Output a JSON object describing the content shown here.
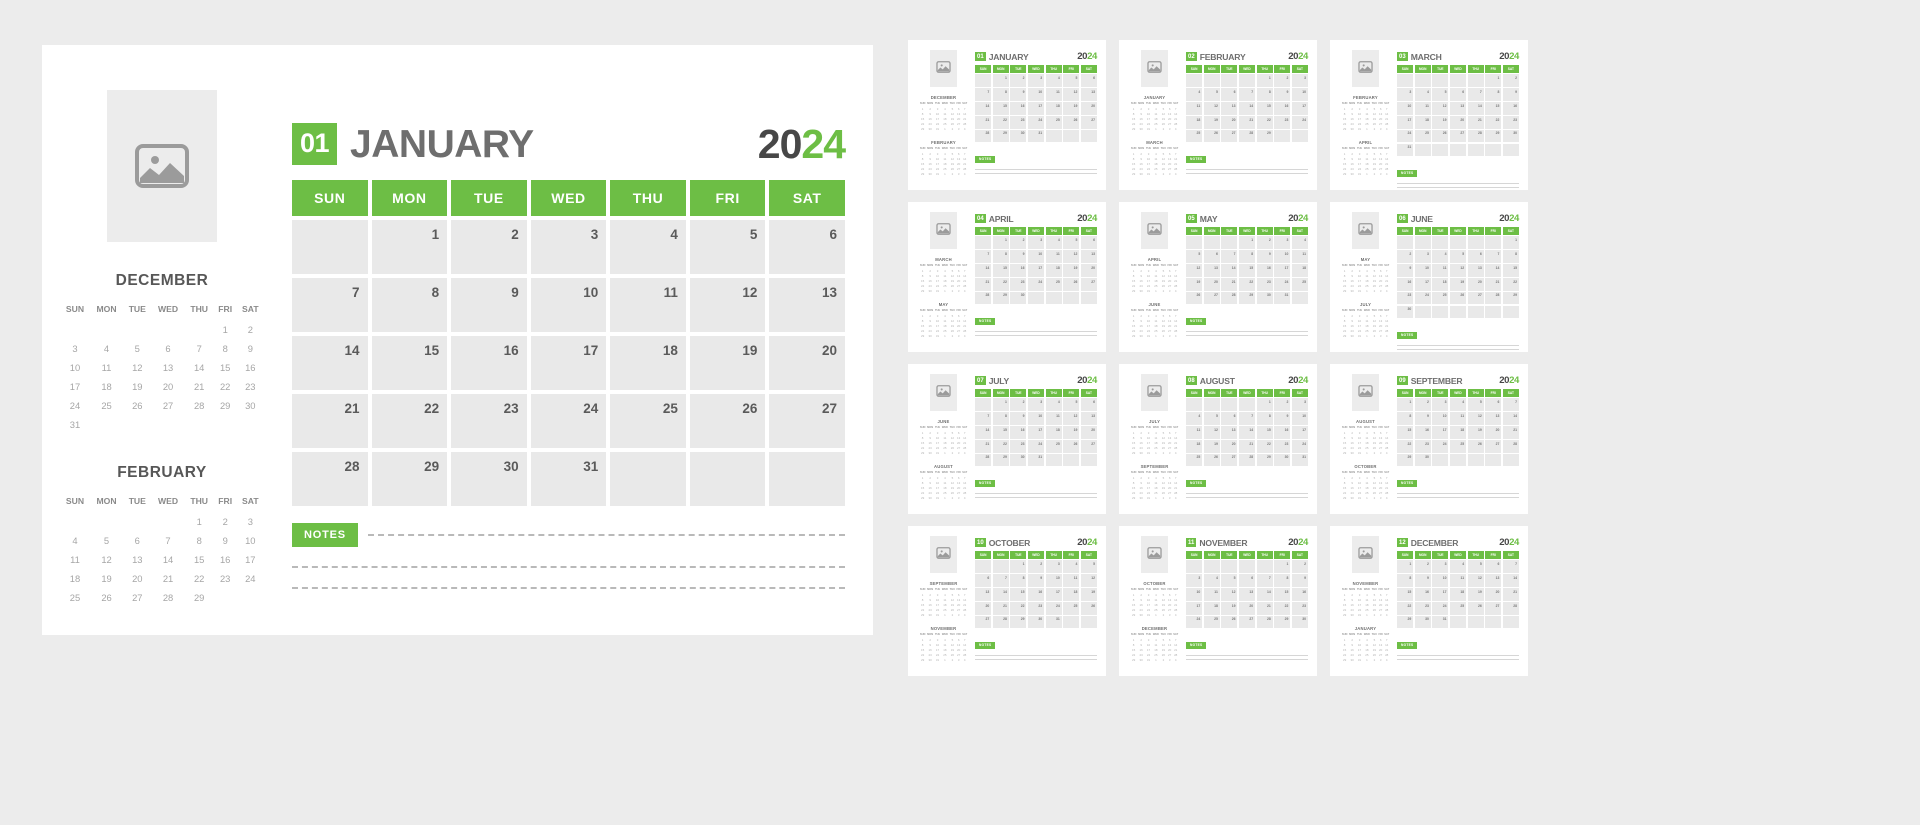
{
  "brand": {
    "green": "#6DBE45",
    "dark": "#474747",
    "gray_text": "#6e6e6e"
  },
  "year": {
    "part1": "20",
    "part2": "24",
    "full": "2024"
  },
  "weekday_headers": [
    "SUN",
    "MON",
    "TUE",
    "WED",
    "THU",
    "FRI",
    "SAT"
  ],
  "mini_weekday_headers": [
    "SUN",
    "MON",
    "TUE",
    "WED",
    "THU",
    "FRI",
    "SAT"
  ],
  "notes": {
    "label": "NOTES"
  },
  "photo_placeholder": {
    "icon": "image-placeholder-icon"
  },
  "main": {
    "month_number": "01",
    "month_name": "JANUARY",
    "weeks": [
      [
        "",
        "1",
        "2",
        "3",
        "4",
        "5",
        "6"
      ],
      [
        "7",
        "8",
        "9",
        "10",
        "11",
        "12",
        "13"
      ],
      [
        "14",
        "15",
        "16",
        "17",
        "18",
        "19",
        "20"
      ],
      [
        "21",
        "22",
        "23",
        "24",
        "25",
        "26",
        "27"
      ],
      [
        "28",
        "29",
        "30",
        "31",
        "",
        "",
        ""
      ]
    ],
    "prev_mini": {
      "title": "DECEMBER",
      "weeks": [
        [
          "",
          "",
          "",
          "",
          "",
          "1",
          "2"
        ],
        [
          "3",
          "4",
          "5",
          "6",
          "7",
          "8",
          "9"
        ],
        [
          "10",
          "11",
          "12",
          "13",
          "14",
          "15",
          "16"
        ],
        [
          "17",
          "18",
          "19",
          "20",
          "21",
          "22",
          "23"
        ],
        [
          "24",
          "25",
          "26",
          "27",
          "28",
          "29",
          "30"
        ],
        [
          "31",
          "",
          "",
          "",
          "",
          "",
          ""
        ]
      ]
    },
    "next_mini": {
      "title": "FEBRUARY",
      "weeks": [
        [
          "",
          "",
          "",
          "",
          "1",
          "2",
          "3"
        ],
        [
          "4",
          "5",
          "6",
          "7",
          "8",
          "9",
          "10"
        ],
        [
          "11",
          "12",
          "13",
          "14",
          "15",
          "16",
          "17"
        ],
        [
          "18",
          "19",
          "20",
          "21",
          "22",
          "23",
          "24"
        ],
        [
          "25",
          "26",
          "27",
          "28",
          "29",
          "",
          ""
        ]
      ]
    }
  },
  "thumbnails": [
    {
      "month_number": "01",
      "month_name": "JANUARY",
      "prev_mini": {
        "title": "DECEMBER"
      },
      "next_mini": {
        "title": "FEBRUARY"
      },
      "weeks": [
        [
          "",
          "1",
          "2",
          "3",
          "4",
          "5",
          "6"
        ],
        [
          "7",
          "8",
          "9",
          "10",
          "11",
          "12",
          "13"
        ],
        [
          "14",
          "15",
          "16",
          "17",
          "18",
          "19",
          "20"
        ],
        [
          "21",
          "22",
          "23",
          "24",
          "25",
          "26",
          "27"
        ],
        [
          "28",
          "29",
          "30",
          "31",
          "",
          "",
          ""
        ]
      ]
    },
    {
      "month_number": "02",
      "month_name": "FEBRUARY",
      "prev_mini": {
        "title": "JANUARY"
      },
      "next_mini": {
        "title": "MARCH"
      },
      "weeks": [
        [
          "",
          "",
          "",
          "",
          "1",
          "2",
          "3"
        ],
        [
          "4",
          "5",
          "6",
          "7",
          "8",
          "9",
          "10"
        ],
        [
          "11",
          "12",
          "13",
          "14",
          "15",
          "16",
          "17"
        ],
        [
          "18",
          "19",
          "20",
          "21",
          "22",
          "23",
          "24"
        ],
        [
          "25",
          "26",
          "27",
          "28",
          "29",
          "",
          ""
        ]
      ]
    },
    {
      "month_number": "03",
      "month_name": "MARCH",
      "prev_mini": {
        "title": "FEBRUARY"
      },
      "next_mini": {
        "title": "APRIL"
      },
      "weeks": [
        [
          "",
          "",
          "",
          "",
          "",
          "1",
          "2"
        ],
        [
          "3",
          "4",
          "5",
          "6",
          "7",
          "8",
          "9"
        ],
        [
          "10",
          "11",
          "12",
          "13",
          "14",
          "15",
          "16"
        ],
        [
          "17",
          "18",
          "19",
          "20",
          "21",
          "22",
          "23"
        ],
        [
          "24",
          "25",
          "26",
          "27",
          "28",
          "29",
          "30"
        ],
        [
          "31",
          "",
          "",
          "",
          "",
          "",
          ""
        ]
      ]
    },
    {
      "month_number": "04",
      "month_name": "APRIL",
      "prev_mini": {
        "title": "MARCH"
      },
      "next_mini": {
        "title": "MAY"
      },
      "weeks": [
        [
          "",
          "1",
          "2",
          "3",
          "4",
          "5",
          "6"
        ],
        [
          "7",
          "8",
          "9",
          "10",
          "11",
          "12",
          "13"
        ],
        [
          "14",
          "15",
          "16",
          "17",
          "18",
          "19",
          "20"
        ],
        [
          "21",
          "22",
          "23",
          "24",
          "25",
          "26",
          "27"
        ],
        [
          "28",
          "29",
          "30",
          "",
          "",
          "",
          ""
        ]
      ]
    },
    {
      "month_number": "05",
      "month_name": "MAY",
      "prev_mini": {
        "title": "APRIL"
      },
      "next_mini": {
        "title": "JUNE"
      },
      "weeks": [
        [
          "",
          "",
          "",
          "1",
          "2",
          "3",
          "4"
        ],
        [
          "5",
          "6",
          "7",
          "8",
          "9",
          "10",
          "11"
        ],
        [
          "12",
          "13",
          "14",
          "15",
          "16",
          "17",
          "18"
        ],
        [
          "19",
          "20",
          "21",
          "22",
          "23",
          "24",
          "25"
        ],
        [
          "26",
          "27",
          "28",
          "29",
          "30",
          "31",
          ""
        ]
      ]
    },
    {
      "month_number": "06",
      "month_name": "JUNE",
      "prev_mini": {
        "title": "MAY"
      },
      "next_mini": {
        "title": "JULY"
      },
      "weeks": [
        [
          "",
          "",
          "",
          "",
          "",
          "",
          "1"
        ],
        [
          "2",
          "3",
          "4",
          "5",
          "6",
          "7",
          "8"
        ],
        [
          "9",
          "10",
          "11",
          "12",
          "13",
          "14",
          "15"
        ],
        [
          "16",
          "17",
          "18",
          "19",
          "20",
          "21",
          "22"
        ],
        [
          "23",
          "24",
          "25",
          "26",
          "27",
          "28",
          "29"
        ],
        [
          "30",
          "",
          "",
          "",
          "",
          "",
          ""
        ]
      ]
    },
    {
      "month_number": "07",
      "month_name": "JULY",
      "prev_mini": {
        "title": "JUNE"
      },
      "next_mini": {
        "title": "AUGUST"
      },
      "weeks": [
        [
          "",
          "1",
          "2",
          "3",
          "4",
          "5",
          "6"
        ],
        [
          "7",
          "8",
          "9",
          "10",
          "11",
          "12",
          "13"
        ],
        [
          "14",
          "15",
          "16",
          "17",
          "18",
          "19",
          "20"
        ],
        [
          "21",
          "22",
          "23",
          "24",
          "25",
          "26",
          "27"
        ],
        [
          "28",
          "29",
          "30",
          "31",
          "",
          "",
          ""
        ]
      ]
    },
    {
      "month_number": "08",
      "month_name": "AUGUST",
      "prev_mini": {
        "title": "JULY"
      },
      "next_mini": {
        "title": "SEPTEMBER"
      },
      "weeks": [
        [
          "",
          "",
          "",
          "",
          "1",
          "2",
          "3"
        ],
        [
          "4",
          "5",
          "6",
          "7",
          "8",
          "9",
          "10"
        ],
        [
          "11",
          "12",
          "13",
          "14",
          "15",
          "16",
          "17"
        ],
        [
          "18",
          "19",
          "20",
          "21",
          "22",
          "23",
          "24"
        ],
        [
          "25",
          "26",
          "27",
          "28",
          "29",
          "30",
          "31"
        ]
      ]
    },
    {
      "month_number": "09",
      "month_name": "SEPTEMBER",
      "prev_mini": {
        "title": "AUGUST"
      },
      "next_mini": {
        "title": "OCTOBER"
      },
      "weeks": [
        [
          "1",
          "2",
          "3",
          "4",
          "5",
          "6",
          "7"
        ],
        [
          "8",
          "9",
          "10",
          "11",
          "12",
          "13",
          "14"
        ],
        [
          "15",
          "16",
          "17",
          "18",
          "19",
          "20",
          "21"
        ],
        [
          "22",
          "23",
          "24",
          "25",
          "26",
          "27",
          "28"
        ],
        [
          "29",
          "30",
          "",
          "",
          "",
          "",
          ""
        ]
      ]
    },
    {
      "month_number": "10",
      "month_name": "OCTOBER",
      "prev_mini": {
        "title": "SEPTEMBER"
      },
      "next_mini": {
        "title": "NOVEMBER"
      },
      "weeks": [
        [
          "",
          "",
          "1",
          "2",
          "3",
          "4",
          "5"
        ],
        [
          "6",
          "7",
          "8",
          "9",
          "10",
          "11",
          "12"
        ],
        [
          "13",
          "14",
          "15",
          "16",
          "17",
          "18",
          "19"
        ],
        [
          "20",
          "21",
          "22",
          "23",
          "24",
          "25",
          "26"
        ],
        [
          "27",
          "28",
          "29",
          "30",
          "31",
          "",
          ""
        ]
      ]
    },
    {
      "month_number": "11",
      "month_name": "NOVEMBER",
      "prev_mini": {
        "title": "OCTOBER"
      },
      "next_mini": {
        "title": "DECEMBER"
      },
      "weeks": [
        [
          "",
          "",
          "",
          "",
          "",
          "1",
          "2"
        ],
        [
          "3",
          "4",
          "5",
          "6",
          "7",
          "8",
          "9"
        ],
        [
          "10",
          "11",
          "12",
          "13",
          "14",
          "15",
          "16"
        ],
        [
          "17",
          "18",
          "19",
          "20",
          "21",
          "22",
          "23"
        ],
        [
          "24",
          "25",
          "26",
          "27",
          "28",
          "29",
          "30"
        ]
      ]
    },
    {
      "month_number": "12",
      "month_name": "DECEMBER",
      "prev_mini": {
        "title": "NOVEMBER"
      },
      "next_mini": {
        "title": "JANUARY"
      },
      "weeks": [
        [
          "1",
          "2",
          "3",
          "4",
          "5",
          "6",
          "7"
        ],
        [
          "8",
          "9",
          "10",
          "11",
          "12",
          "13",
          "14"
        ],
        [
          "15",
          "16",
          "17",
          "18",
          "19",
          "20",
          "21"
        ],
        [
          "22",
          "23",
          "24",
          "25",
          "26",
          "27",
          "28"
        ],
        [
          "29",
          "30",
          "31",
          "",
          "",
          "",
          ""
        ]
      ]
    }
  ]
}
